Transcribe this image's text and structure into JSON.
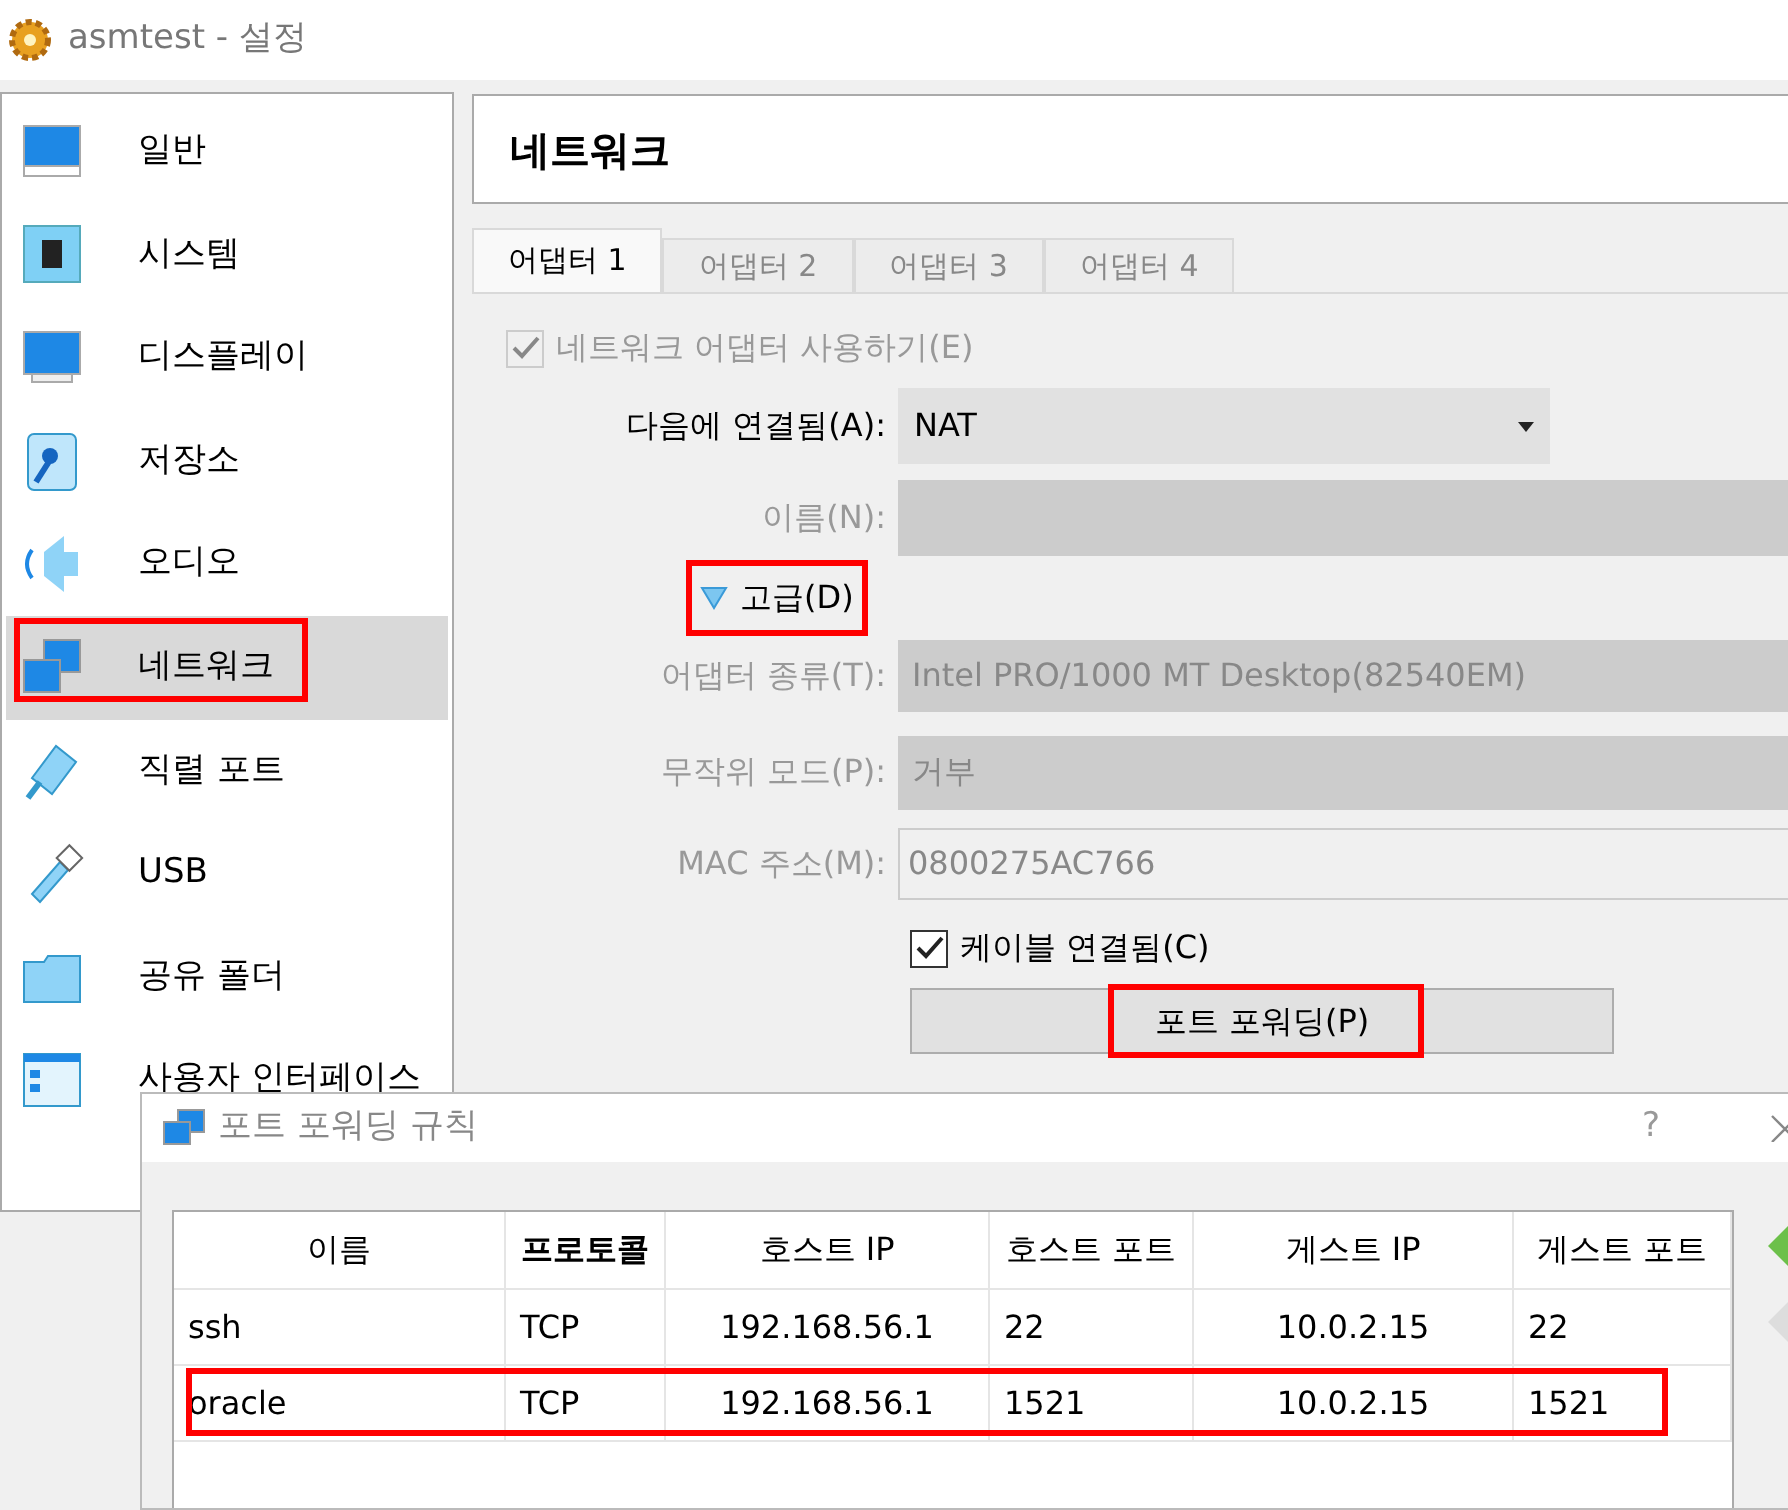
{
  "window": {
    "title": "asmtest - 설정"
  },
  "sidebar": {
    "items": [
      {
        "label": "일반",
        "selected": false,
        "annotated": false
      },
      {
        "label": "시스템",
        "selected": false,
        "annotated": false
      },
      {
        "label": "디스플레이",
        "selected": false,
        "annotated": false
      },
      {
        "label": "저장소",
        "selected": false,
        "annotated": false
      },
      {
        "label": "오디오",
        "selected": false,
        "annotated": false
      },
      {
        "label": "네트워크",
        "selected": true,
        "annotated": true
      },
      {
        "label": "직렬 포트",
        "selected": false,
        "annotated": false
      },
      {
        "label": "USB",
        "selected": false,
        "annotated": false
      },
      {
        "label": "공유 폴더",
        "selected": false,
        "annotated": false
      },
      {
        "label": "사용자 인터페이스",
        "selected": false,
        "annotated": false
      }
    ]
  },
  "page_title": "네트워크",
  "tabs": [
    {
      "label": "어댑터 1",
      "selected": true
    },
    {
      "label": "어댑터 2",
      "selected": false
    },
    {
      "label": "어댑터 3",
      "selected": false
    },
    {
      "label": "어댑터 4",
      "selected": false
    }
  ],
  "enable_adapter": {
    "label": "네트워크 어댑터 사용하기(E)",
    "checked": true,
    "disabled": true
  },
  "attached_to": {
    "label": "다음에 연결됨(A):",
    "value": "NAT"
  },
  "name": {
    "label": "이름(N):"
  },
  "advanced": {
    "label": "고급(D)",
    "expanded": true,
    "annotated": true
  },
  "adapter_type": {
    "label": "어댑터 종류(T):",
    "value": "Intel PRO/1000 MT Desktop(82540EM)"
  },
  "promiscuous": {
    "label": "무작위 모드(P):",
    "value": "거부"
  },
  "mac": {
    "label": "MAC 주소(M):",
    "value": "0800275AC766"
  },
  "cable": {
    "label": "케이블 연결됨(C)",
    "checked": true,
    "disabled": false
  },
  "port_forwarding_button": {
    "label": "포트 포워딩(P)",
    "annotated": true
  },
  "dialog": {
    "title": "포트 포워딩 규칙",
    "help": "?",
    "columns": [
      {
        "label": "이름",
        "sorted": false
      },
      {
        "label": "프로토콜",
        "sorted": true
      },
      {
        "label": "호스트 IP",
        "sorted": false
      },
      {
        "label": "호스트 포트",
        "sorted": false
      },
      {
        "label": "게스트 IP",
        "sorted": false
      },
      {
        "label": "게스트 포트",
        "sorted": false
      }
    ],
    "rows": [
      {
        "cells": [
          "ssh",
          "TCP",
          "192.168.56.1",
          "22",
          "10.0.2.15",
          "22"
        ],
        "annotated": false
      },
      {
        "cells": [
          "oracle",
          "TCP",
          "192.168.56.1",
          "1521",
          "10.0.2.15",
          "1521"
        ],
        "annotated": true
      }
    ]
  }
}
